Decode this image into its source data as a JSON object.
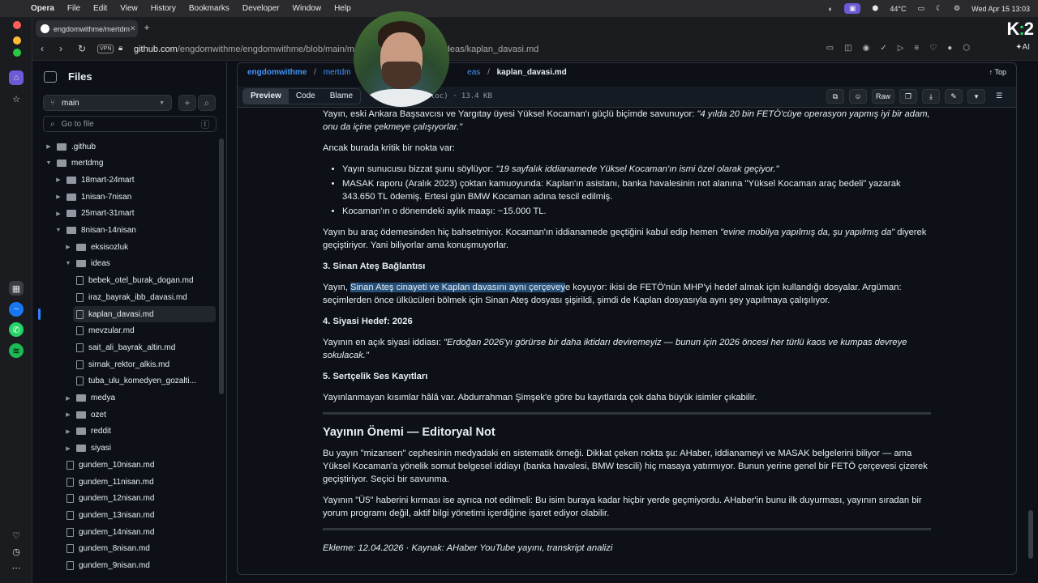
{
  "menubar": {
    "app": "Opera",
    "items": [
      "File",
      "Edit",
      "View",
      "History",
      "Bookmarks",
      "Developer",
      "Window",
      "Help"
    ],
    "temp": "44°C",
    "clock": "Wed Apr 15  13:03"
  },
  "tab": {
    "title": "engdomwithme/mertdm"
  },
  "address": {
    "vpn": "VPN",
    "host": "github.com",
    "path_a": "/engdomwithme/engdomwithme/blob/main/m",
    "path_b": "n/ideas/kaplan_davasi.md"
  },
  "ai_label": "AI",
  "sidebar": {
    "title": "Files",
    "branch": "main",
    "goto_placeholder": "Go to file",
    "goto_key": "t",
    "tree": [
      {
        "label": ".github",
        "type": "folder",
        "depth": 0,
        "open": false
      },
      {
        "label": "mertdmg",
        "type": "folder",
        "depth": 0,
        "open": true
      },
      {
        "label": "18mart-24mart",
        "type": "folder",
        "depth": 1,
        "open": false
      },
      {
        "label": "1nisan-7nisan",
        "type": "folder",
        "depth": 1,
        "open": false
      },
      {
        "label": "25mart-31mart",
        "type": "folder",
        "depth": 1,
        "open": false
      },
      {
        "label": "8nisan-14nisan",
        "type": "folder",
        "depth": 1,
        "open": true
      },
      {
        "label": "eksisozluk",
        "type": "folder",
        "depth": 2,
        "open": false
      },
      {
        "label": "ideas",
        "type": "folder",
        "depth": 2,
        "open": true
      },
      {
        "label": "bebek_otel_burak_dogan.md",
        "type": "file",
        "depth": 3
      },
      {
        "label": "iraz_bayrak_ibb_davasi.md",
        "type": "file",
        "depth": 3
      },
      {
        "label": "kaplan_davasi.md",
        "type": "file",
        "depth": 3,
        "selected": true
      },
      {
        "label": "mevzular.md",
        "type": "file",
        "depth": 3
      },
      {
        "label": "sait_ali_bayrak_altin.md",
        "type": "file",
        "depth": 3
      },
      {
        "label": "sirnak_rektor_alkis.md",
        "type": "file",
        "depth": 3
      },
      {
        "label": "tuba_ulu_komedyen_gozalti...",
        "type": "file",
        "depth": 3
      },
      {
        "label": "medya",
        "type": "folder",
        "depth": 2,
        "open": false
      },
      {
        "label": "ozet",
        "type": "folder",
        "depth": 2,
        "open": false
      },
      {
        "label": "reddit",
        "type": "folder",
        "depth": 2,
        "open": false
      },
      {
        "label": "siyasi",
        "type": "folder",
        "depth": 2,
        "open": false
      },
      {
        "label": "gundem_10nisan.md",
        "type": "file",
        "depth": 2
      },
      {
        "label": "gundem_11nisan.md",
        "type": "file",
        "depth": 2
      },
      {
        "label": "gundem_12nisan.md",
        "type": "file",
        "depth": 2
      },
      {
        "label": "gundem_13nisan.md",
        "type": "file",
        "depth": 2
      },
      {
        "label": "gundem_14nisan.md",
        "type": "file",
        "depth": 2
      },
      {
        "label": "gundem_8nisan.md",
        "type": "file",
        "depth": 2
      },
      {
        "label": "gundem_9nisan.md",
        "type": "file",
        "depth": 2
      }
    ]
  },
  "breadcrumb": {
    "repo": "engdomwithme",
    "dir1": "mertdm",
    "dir_last": "eas",
    "file": "kaplan_davasi.md"
  },
  "top_label": "Top",
  "toolbar": {
    "preview": "Preview",
    "code": "Code",
    "blame": "Blame",
    "meta": "loc) · 13.4 KB",
    "raw": "Raw"
  },
  "doc": {
    "p1_a": "Yayın, eski Ankara Başsavcısı ve Yargıtay üyesi Yüksel Kocaman'ı güçlü biçimde savunuyor: ",
    "p1_q": "\"4 yılda 20 bin FETÖ'cüye operasyon yapmış iyi bir adam, onu da içine çekmeye çalışıyorlar.\"",
    "p2": "Ancak burada kritik bir nokta var:",
    "li1_a": "Yayın sunucusu bizzat şunu söylüyor: ",
    "li1_q": "\"19 sayfalık iddianamede Yüksel Kocaman'ın ismi özel olarak geçiyor.\"",
    "li2": "MASAK raporu (Aralık 2023) çoktan kamuoyunda: Kaplan'ın asistanı, banka havalesinin not alanına \"Yüksel Kocaman araç bedeli\" yazarak 343.650 TL ödemiş. Ertesi gün BMW Kocaman adına tescil edilmiş.",
    "li3": "Kocaman'ın o dönemdeki aylık maaşı: ~15.000 TL.",
    "p3_a": "Yayın bu araç ödemesinden hiç bahsetmiyor. Kocaman'ın iddianamede geçtiğini kabul edip hemen ",
    "p3_q": "\"evine mobilya yapılmış da, şu yapılmış da\"",
    "p3_b": " diyerek geçiştiriyor. Yani biliyorlar ama konuşmuyorlar.",
    "h3": "3. Sinan Ateş Bağlantısı",
    "p4_a": "Yayın, ",
    "p4_hl": "Sinan Ateş cinayeti ve Kaplan davasını aynı çerçevey",
    "p4_b": "e koyuyor: ikisi de FETÖ'nün MHP'yi hedef almak için kullandığı dosyalar. Argüman: seçimlerden önce ülkücüleri bölmek için Sinan Ateş dosyası şişirildi, şimdi de Kaplan dosyasıyla aynı şey yapılmaya çalışılıyor.",
    "h4": "4. Siyasi Hedef: 2026",
    "p5_a": "Yayının en açık siyasi iddiası: ",
    "p5_q": "\"Erdoğan 2026'yı görürse bir daha iktidarı deviremeyiz — bunun için 2026 öncesi her türlü kaos ve kumpas devreye sokulacak.\"",
    "h5": "5. Sertçelik Ses Kayıtları",
    "p6": "Yayınlanmayan kısımlar hâlâ var. Abdurrahman Şimşek'e göre bu kayıtlarda çok daha büyük isimler çıkabilir.",
    "h2": "Yayının Önemi — Editoryal Not",
    "p7": "Bu yayın \"mizansen\" cephesinin medyadaki en sistematik örneği. Dikkat çeken nokta şu: AHaber, iddianameyi ve MASAK belgelerini biliyor — ama Yüksel Kocaman'a yönelik somut belgesel iddiayı (banka havalesi, BMW tescili) hiç masaya yatırmıyor. Bunun yerine genel bir FETÖ çerçevesi çizerek geçiştiriyor. Seçici bir savunma.",
    "p8": "Yayının \"Ü5\" haberini kırması ise ayrıca not edilmeli: Bu isim buraya kadar hiçbir yerde geçmiyordu. AHaber'in bunu ilk duyurması, yayının sıradan bir yorum programı değil, aktif bilgi yönetimi içerdiğine işaret ediyor olabilir.",
    "footer": "Ekleme: 12.04.2026 · Kaynak: AHaber YouTube yayını, transkript analizi"
  },
  "colors": {
    "accent": "#4493f8",
    "selection": "#264f78",
    "bg": "#0d1117"
  }
}
